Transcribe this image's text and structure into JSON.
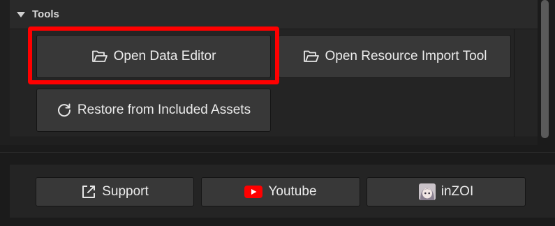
{
  "tools": {
    "title": "Tools",
    "buttons": {
      "open_data_editor": "Open Data Editor",
      "open_resource_import_tool": "Open Resource Import Tool",
      "restore_from_included_assets": "Restore from Included Assets"
    }
  },
  "footer": {
    "support": "Support",
    "youtube": "Youtube",
    "inzoi": "inZOI"
  },
  "colors": {
    "highlight": "#ff0000",
    "youtube_red": "#ff0000"
  },
  "icons": {
    "tools_collapse": "caret-down-icon",
    "open_data_editor": "folder-open-icon",
    "open_resource_import_tool": "folder-open-icon",
    "restore": "refresh-icon",
    "support": "external-link-icon",
    "youtube": "youtube-icon",
    "inzoi": "inzoi-avatar-icon"
  }
}
